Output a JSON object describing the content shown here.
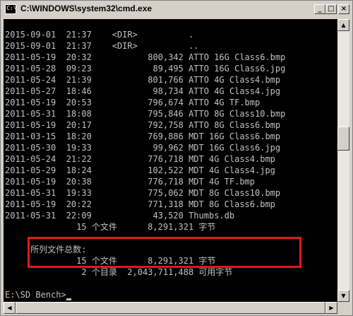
{
  "window": {
    "title": "C:\\WINDOWS\\system32\\cmd.exe",
    "icon": "cmd-icon",
    "minimize_label": "_",
    "maximize_label": "□",
    "close_label": "×"
  },
  "console": {
    "lines": [
      "2015-09-01  21:37    <DIR>          .",
      "2015-09-01  21:37    <DIR>          ..",
      "2011-05-19  20:32           800,342 ATTO 16G Class6.bmp",
      "2011-05-28  09:23            89,495 ATTO 16G Class6.jpg",
      "2011-05-24  21:39           801,766 ATTO 4G Class4.bmp",
      "2011-05-27  18:46            98,734 ATTO 4G Class4.jpg",
      "2011-05-19  20:53           796,674 ATTO 4G TF.bmp",
      "2011-05-31  18:08           795,846 ATTO 8G Class10.bmp",
      "2011-05-19  20:17           792,758 ATTO 8G Class6.bmp",
      "2011-03-15  18:20           769,886 MDT 16G Class6.bmp",
      "2011-05-30  19:33            99,962 MDT 16G Class6.jpg",
      "2011-05-24  21:22           776,718 MDT 4G Class4.bmp",
      "2011-05-29  18:24           102,522 MDT 4G Class4.jpg",
      "2011-05-19  20:38           776,718 MDT 4G TF.bmp",
      "2011-05-31  19:33           775,062 MDT 8G Class10.bmp",
      "2011-05-19  20:22           771,318 MDT 8G Class6.bmp",
      "2011-05-31  22:09            43,520 Thumbs.db",
      "              15 个文件      8,291,321 字节",
      "",
      "     所列文件总数:",
      "              15 个文件      8,291,321 字节",
      "               2 个目录  2,043,711,488 可用字节",
      "",
      "E:\\SD Bench>"
    ]
  },
  "scrollbars": {
    "up_arrow": "▲",
    "down_arrow": "▼",
    "left_arrow": "◀",
    "right_arrow": "▶",
    "vertical_position": 0.95
  }
}
